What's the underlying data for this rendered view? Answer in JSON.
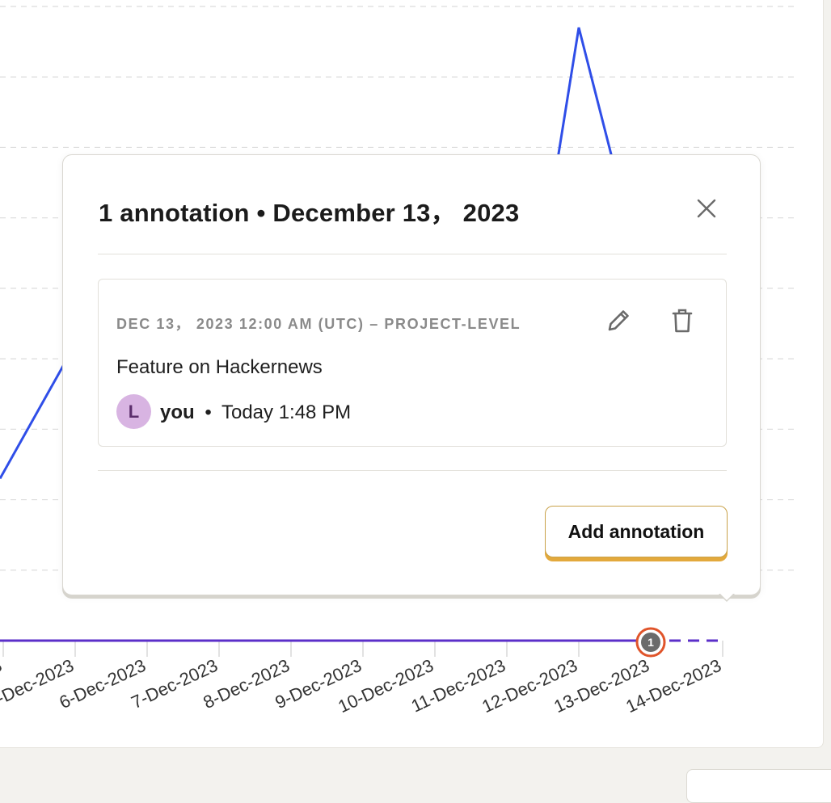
{
  "chart_data": {
    "type": "line",
    "categories": [
      "4-Dec-2023",
      "5-Dec-2023",
      "6-Dec-2023",
      "7-Dec-2023",
      "8-Dec-2023",
      "9-Dec-2023",
      "10-Dec-2023",
      "11-Dec-2023",
      "12-Dec-2023",
      "13-Dec-2023",
      "14-Dec-2023"
    ],
    "tick_labels_visible": [
      "3",
      "5-Dec-2023",
      "6-Dec-2023",
      "7-Dec-2023",
      "8-Dec-2023",
      "9-Dec-2023",
      "10-Dec-2023",
      "11-Dec-2023",
      "12-Dec-2023",
      "13-Dec-2023",
      "14-Dec-2023"
    ],
    "series": [
      {
        "color": "#2f4ee8",
        "values": [
          2.3,
          null,
          null,
          null,
          null,
          null,
          null,
          null,
          8.7,
          null,
          null
        ],
        "dashed_from_index": 9,
        "end_value": 1.5
      },
      {
        "color": "#5b2fc9",
        "values": [
          0,
          0,
          0,
          0,
          0,
          0,
          0,
          0,
          0,
          0,
          0
        ],
        "dashed_from_index": 9
      }
    ],
    "ylim": [
      0,
      9
    ],
    "grid": true,
    "annotation_marker": {
      "category": "13-Dec-2023",
      "count": "1"
    }
  },
  "popover": {
    "title_count": "1 annotation",
    "title_separator": "•",
    "title_date": "December 13， 2023",
    "close_icon": "close-icon",
    "annotation": {
      "meta": "DEC 13， 2023 12:00 AM (UTC) – PROJECT-LEVEL",
      "text": "Feature on Hackernews",
      "author_initial": "L",
      "author_name": "you",
      "separator": "•",
      "time": "Today 1:48 PM",
      "edit_icon": "pencil-icon",
      "delete_icon": "trash-icon"
    },
    "add_button_label": "Add annotation"
  },
  "colors": {
    "line_primary": "#2f4ee8",
    "line_secondary": "#5b2fc9",
    "marker_ring": "#e0542a",
    "marker_fill": "#6b6b6b",
    "avatar_bg": "#d8b4e2",
    "button_accent": "#e3a93c"
  }
}
